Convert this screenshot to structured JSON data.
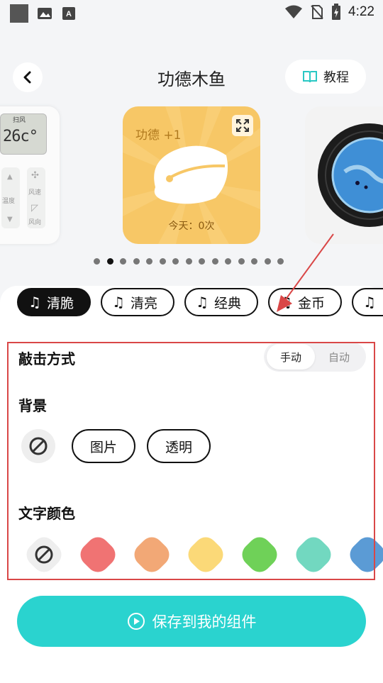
{
  "status_bar": {
    "time": "4:22"
  },
  "header": {
    "title": "功德木鱼",
    "tutorial_label": "教程"
  },
  "carousel": {
    "remote": {
      "mode": "扫风",
      "temperature": "26c°",
      "label_speed": "风速",
      "label_temp": "温度",
      "label_direction": "风向"
    },
    "muyu": {
      "merit": "功德 +1",
      "today": "今天：0次"
    },
    "dot_count": 15,
    "active_dot": 1
  },
  "sounds": [
    {
      "label": "清脆",
      "selected": true
    },
    {
      "label": "清亮",
      "selected": false
    },
    {
      "label": "经典",
      "selected": false
    },
    {
      "label": "金币",
      "selected": false
    },
    {
      "label": "",
      "selected": false
    }
  ],
  "strike_mode": {
    "title": "敲击方式",
    "options": [
      "手动",
      "自动"
    ],
    "selected": "手动"
  },
  "background": {
    "title": "背景",
    "options": [
      "图片",
      "透明"
    ]
  },
  "text_color": {
    "title": "文字颜色",
    "swatches": [
      "#f07373",
      "#f2a876",
      "#fbd978",
      "#6fd158",
      "#72d8c0",
      "#5b9bd5"
    ]
  },
  "save_button": {
    "label": "保存到我的组件"
  }
}
